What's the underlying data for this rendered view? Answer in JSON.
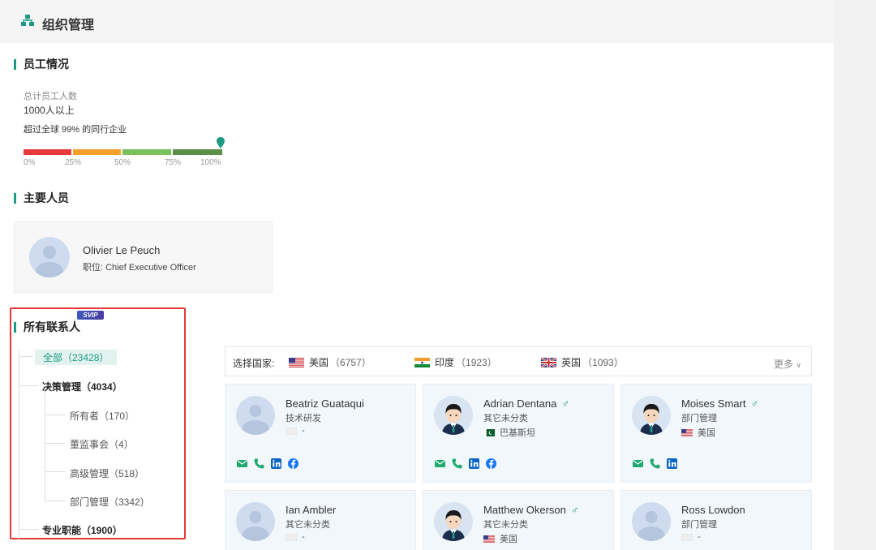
{
  "header": {
    "title": "组织管理"
  },
  "employees": {
    "section_title": "员工情况",
    "total_label": "总计员工人数",
    "total_value": "1000人以上",
    "percentile_text": "超过全球 99% 的同行企业",
    "bar_ticks": [
      "0%",
      "25%",
      "50%",
      "75%",
      "100%"
    ],
    "bar_colors": [
      "#e8393b",
      "#f5a02d",
      "#7ac05c",
      "#5b8e46"
    ],
    "percentile_value": 0.99
  },
  "key_people": {
    "section_title": "主要人员",
    "person": {
      "name": "Olivier Le Peuch",
      "position": "职位: Chief Executive Officer"
    }
  },
  "contacts": {
    "section_title": "所有联系人",
    "badge": "SVIP",
    "tree": [
      {
        "label": "全部（23428）",
        "level": 0,
        "active": true
      },
      {
        "label": "决策管理（4034）",
        "level": 0,
        "active": false
      },
      {
        "label": "所有者（170）",
        "level": 1,
        "active": false
      },
      {
        "label": "董监事会（4）",
        "level": 1,
        "active": false
      },
      {
        "label": "高级管理（518）",
        "level": 1,
        "active": false
      },
      {
        "label": "部门管理（3342）",
        "level": 1,
        "active": false
      },
      {
        "label": "专业职能（1900）",
        "level": 0,
        "active": false
      }
    ],
    "country_filter": {
      "label": "选择国家:",
      "countries": [
        {
          "name": "美国",
          "count": "（6757）",
          "flag": "us-flag"
        },
        {
          "name": "印度",
          "count": "（1923）",
          "flag": "india-flag"
        },
        {
          "name": "英国",
          "count": "（1093）",
          "flag": "uk-flag"
        }
      ],
      "more": "更多"
    },
    "cards": [
      {
        "name": "Beatriz Guataqui",
        "role": "技术研发",
        "location": "-",
        "flag": "blank-flag",
        "male": false,
        "photo": "placeholder",
        "actions": [
          "email-icon",
          "phone-icon",
          "linkedin-icon",
          "facebook-icon"
        ]
      },
      {
        "name": "Adrian Dentana",
        "role": "其它未分类",
        "location": "巴基斯坦",
        "flag": "pakistan-flag",
        "male": true,
        "photo": "man",
        "actions": [
          "email-icon",
          "phone-icon",
          "linkedin-icon",
          "facebook-icon"
        ]
      },
      {
        "name": "Moises Smart",
        "role": "部门管理",
        "location": "美国",
        "flag": "us-flag",
        "male": true,
        "photo": "man",
        "actions": [
          "email-icon",
          "phone-icon",
          "linkedin-icon"
        ]
      },
      {
        "name": "Ian Ambler",
        "role": "其它未分类",
        "location": "-",
        "flag": "blank-flag",
        "male": false,
        "photo": "placeholder",
        "actions": []
      },
      {
        "name": "Matthew Okerson",
        "role": "其它未分类",
        "location": "美国",
        "flag": "us-flag",
        "male": true,
        "photo": "man",
        "actions": []
      },
      {
        "name": "Ross Lowdon",
        "role": "部门管理",
        "location": "-",
        "flag": "blank-flag",
        "male": false,
        "photo": "placeholder",
        "actions": []
      }
    ],
    "male_symbol": "♂"
  },
  "colors": {
    "accent": "#1e9a84",
    "highlight_box": "#e53935"
  }
}
